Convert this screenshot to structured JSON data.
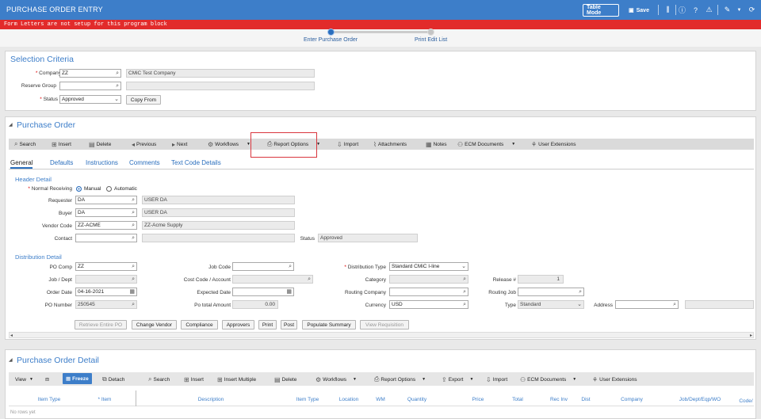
{
  "app": {
    "title": "PURCHASE ORDER ENTRY",
    "table_mode": "Table Mode",
    "save": "Save"
  },
  "alert": {
    "message": "Form Letters are not setup for this program block"
  },
  "wizard": {
    "step1": "Enter Purchase Order",
    "step2": "Print Edit List"
  },
  "selection": {
    "title": "Selection Criteria",
    "company_label": "Company",
    "company_value": "ZZ",
    "company_name": "CMiC Test Company",
    "reserve_label": "Reserve Group",
    "reserve_value": "",
    "reserve_name": "",
    "status_label": "Status",
    "status_value": "Approved",
    "copy_from": "Copy From"
  },
  "po": {
    "title": "Purchase Order",
    "toolbar": [
      "Search",
      "Insert",
      "Delete",
      "Previous",
      "Next",
      "Workflows",
      "Report Options",
      "Import",
      "Attachments",
      "Notes",
      "ECM Documents",
      "User Extensions"
    ],
    "tabs": [
      "General",
      "Defaults",
      "Instructions",
      "Comments",
      "Text Code Details"
    ],
    "header_detail": "Header Detail",
    "normal_receiving": "Normal Receiving",
    "manual": "Manual",
    "automatic": "Automatic",
    "requester_label": "Requester",
    "requester_value": "DA",
    "requester_name": "USER DA",
    "buyer_label": "Buyer",
    "buyer_value": "DA",
    "buyer_name": "USER DA",
    "vendor_label": "Vendor Code",
    "vendor_value": "ZZ-ACME",
    "vendor_name": "ZZ-Acme Supply",
    "contact_label": "Contact",
    "contact_value": "",
    "contact_name": "",
    "status_label": "Status",
    "status_value": "Approved",
    "distribution_detail": "Distribution Detail",
    "po_comp_label": "PO Comp",
    "po_comp_value": "ZZ",
    "job_dept_label": "Job / Dept",
    "job_dept_value": "",
    "order_date_label": "Order Date",
    "order_date_value": "04-16-2021",
    "po_number_label": "PO Number",
    "po_number_value": "250545",
    "job_code_label": "Job Code",
    "job_code_value": "",
    "cost_code_label": "Cost Code / Account",
    "cost_code_value": "",
    "expected_date_label": "Expected Date",
    "expected_date_value": "",
    "po_total_label": "Po total Amount",
    "po_total_value": "0.00",
    "dist_type_label": "Distribution Type",
    "dist_type_value": "Standard CMiC I-line",
    "category_label": "Category",
    "category_value": "",
    "routing_company_label": "Routing Company",
    "routing_company_value": "",
    "currency_label": "Currency",
    "currency_value": "USD",
    "release_label": "Release #",
    "release_value": "1",
    "routing_job_label": "Routing Job",
    "routing_job_value": "",
    "type_label": "Type",
    "type_value": "Standard",
    "address_label": "Address",
    "address_value": "",
    "buttons": [
      "Retrieve Entire PO",
      "Change Vendor",
      "Compliance",
      "Approvers",
      "Print",
      "Post",
      "Populate Summary",
      "View Requisition"
    ]
  },
  "pod": {
    "title": "Purchase Order Detail",
    "toolbar": [
      "View",
      "Freeze",
      "Detach",
      "Search",
      "Insert",
      "Insert Multiple",
      "Delete",
      "Workflows",
      "Report Options",
      "Export",
      "Import",
      "ECM Documents",
      "User Extensions"
    ],
    "columns": [
      "Item Type",
      "* Item",
      "Description",
      "Item Type",
      "Location",
      "WM",
      "Quantity",
      "Price",
      "Total",
      "Rec Inv",
      "Dist",
      "Company",
      "Job/Dept/Eqp/WO",
      "Code/"
    ],
    "empty": "No rows yet"
  },
  "colors": {
    "brand": "#3d7ec9",
    "alert": "#e22b2b",
    "highlight": "#d9363e"
  }
}
